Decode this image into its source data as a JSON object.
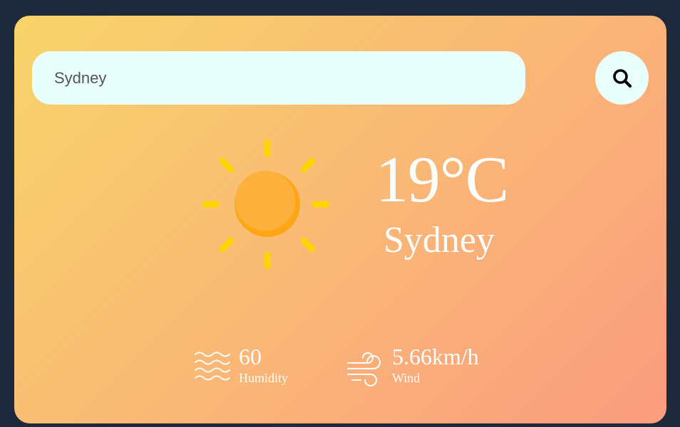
{
  "search": {
    "value": "Sydney",
    "button_icon": "search-icon"
  },
  "weather": {
    "icon": "sun-icon",
    "temperature": "19°C",
    "city": "Sydney"
  },
  "details": {
    "humidity": {
      "value": "60",
      "label": "Humidity",
      "icon": "humidity-icon"
    },
    "wind": {
      "value": "5.66km/h",
      "label": "Wind",
      "icon": "wind-icon"
    }
  },
  "colors": {
    "page_background": "#1e293b",
    "card_gradient_start": "#f7d46a",
    "card_gradient_end": "#fb9d80",
    "input_background": "#e9fffb",
    "sun_rays": "#ffd400",
    "sun_body": "#fdb13d"
  }
}
